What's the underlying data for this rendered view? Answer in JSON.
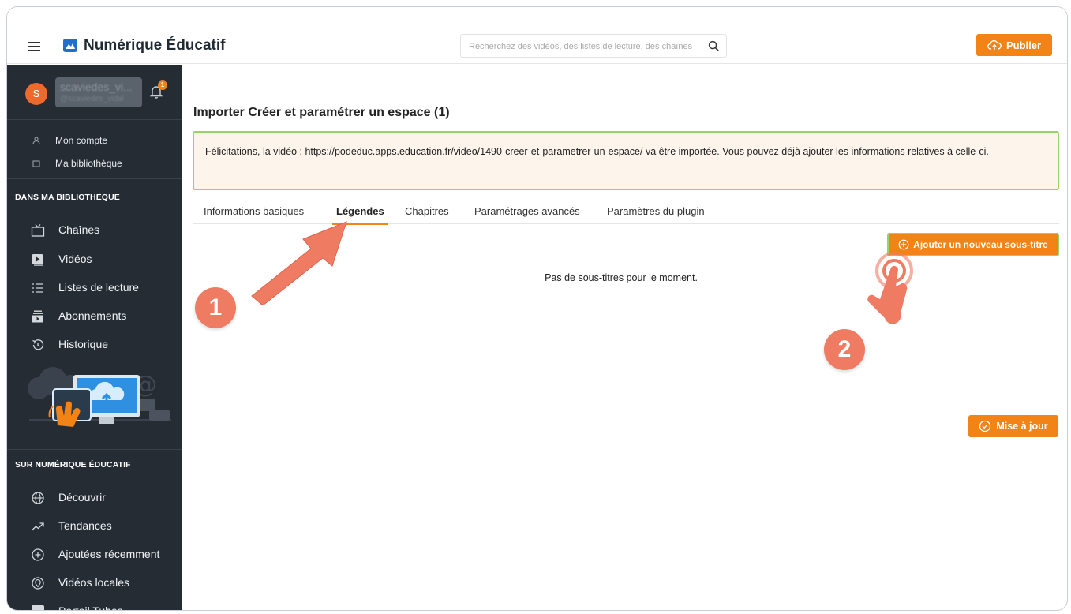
{
  "header": {
    "brand": "Numérique Éducatif",
    "search_placeholder": "Recherchez des vidéos, des listes de lecture, des chaînes",
    "publish_label": "Publier"
  },
  "sidebar": {
    "user": {
      "avatar_letter": "S",
      "name": "scaviedes_vi...",
      "handle": "@scaviedes_vidal",
      "notification_count": "1"
    },
    "account_items": [
      {
        "label": "Mon compte",
        "icon": "user-icon"
      },
      {
        "label": "Ma bibliothèque",
        "icon": "folder-icon"
      }
    ],
    "library_title": "DANS MA BIBLIOTHÈQUE",
    "library_items": [
      {
        "label": "Chaînes",
        "icon": "tv-icon"
      },
      {
        "label": "Vidéos",
        "icon": "video-icon"
      },
      {
        "label": "Listes de lecture",
        "icon": "list-icon"
      },
      {
        "label": "Abonnements",
        "icon": "subscriptions-icon"
      },
      {
        "label": "Historique",
        "icon": "history-icon"
      }
    ],
    "site_title": "SUR NUMÉRIQUE ÉDUCATIF",
    "site_items": [
      {
        "label": "Découvrir",
        "icon": "globe-icon"
      },
      {
        "label": "Tendances",
        "icon": "trending-icon"
      },
      {
        "label": "Ajoutées récemment",
        "icon": "plus-circle-icon"
      },
      {
        "label": "Vidéos locales",
        "icon": "location-icon"
      },
      {
        "label": "Portail Tubes",
        "icon": "portal-icon"
      }
    ]
  },
  "main": {
    "title": "Importer Créer et paramétrer un espace (1)",
    "alert_text": "Félicitations, la vidéo : https://podeduc.apps.education.fr/video/1490-creer-et-parametrer-un-espace/ va être importée. Vous pouvez déjà ajouter les informations relatives à celle-ci.",
    "tabs": [
      {
        "label": "Informations basiques",
        "active": false
      },
      {
        "label": "Légendes",
        "active": true
      },
      {
        "label": "Chapitres",
        "active": false
      },
      {
        "label": "Paramétrages avancés",
        "active": false
      },
      {
        "label": "Paramètres du plugin",
        "active": false
      }
    ],
    "add_subtitle_label": "Ajouter un nouveau sous-titre",
    "empty_message": "Pas de sous-titres pour le moment.",
    "update_label": "Mise à jour"
  },
  "annotations": {
    "step1": "1",
    "step2": "2"
  },
  "colors": {
    "accent": "#f28316",
    "sidebar_bg": "#252c34",
    "alert_bg": "#fdf5ec",
    "alert_border": "#98d36a",
    "annotation": "#f07b63"
  }
}
